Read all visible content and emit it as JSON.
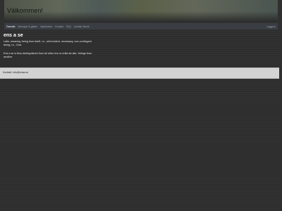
{
  "banner": {
    "title": "Välkommen!"
  },
  "nav": {
    "items": [
      "Översikt",
      "Intervjuer & gäster",
      "Nyhetsbrev",
      "Kontakt",
      "FAQ",
      "Juridisk Teknik"
    ],
    "login": "Logga in"
  },
  "main": {
    "heading": "ens a se",
    "paragraph1": "Latin, meaning 'being from itself, i.e., self-evident, necessary, non-contingent being; i.e., God.",
    "paragraph2": "Ens a se is thus distinguished from all other ens or entia ab alio, 'beings from another."
  },
  "footer": {
    "contact": "Kontakt: info@ensa.se"
  }
}
